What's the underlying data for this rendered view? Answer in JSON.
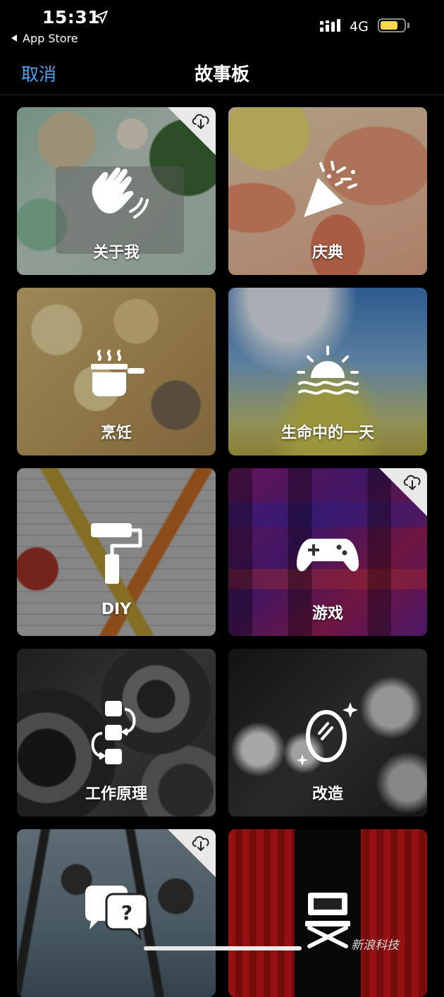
{
  "status_bar": {
    "time": "15:31",
    "back_app": "App Store",
    "network": "4G",
    "battery_fraction": 0.75
  },
  "navbar": {
    "cancel_label": "取消",
    "title": "故事板"
  },
  "tiles": [
    {
      "label": "关于我",
      "icon": "waving-hand-icon",
      "downloadable": true
    },
    {
      "label": "庆典",
      "icon": "party-popper-icon",
      "downloadable": false
    },
    {
      "label": "烹饪",
      "icon": "cooking-pot-icon",
      "downloadable": false
    },
    {
      "label": "生命中的一天",
      "icon": "sunrise-icon",
      "downloadable": false
    },
    {
      "label": "DIY",
      "icon": "paint-roller-icon",
      "downloadable": false
    },
    {
      "label": "游戏",
      "icon": "game-controller-icon",
      "downloadable": true
    },
    {
      "label": "工作原理",
      "icon": "process-flow-icon",
      "downloadable": false
    },
    {
      "label": "改造",
      "icon": "mirror-sparkle-icon",
      "downloadable": false
    },
    {
      "label": "",
      "icon": "question-chat-icon",
      "downloadable": true
    },
    {
      "label": "",
      "icon": "director-chair-icon",
      "downloadable": false
    }
  ],
  "watermark": "新浪科技",
  "colors": {
    "accent": "#4aa3f2",
    "background": "#000000",
    "battery": "#f5d94a"
  }
}
